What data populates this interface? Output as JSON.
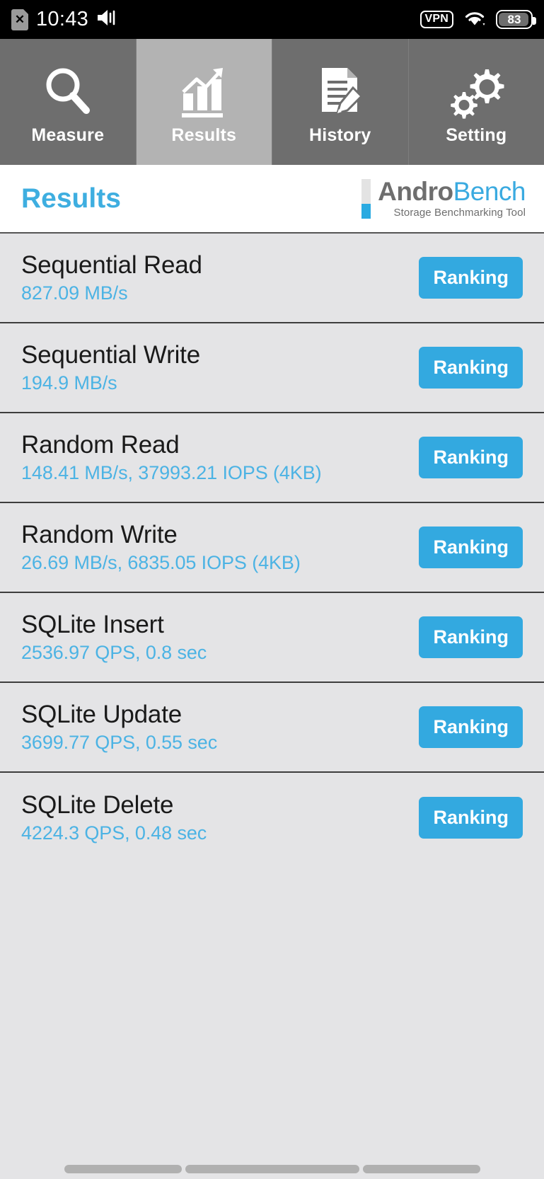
{
  "status_bar": {
    "sim_icon": "sim-card-disabled-icon",
    "sim_glyph": "✕",
    "time": "10:43",
    "volume_icon": "volume-on-icon",
    "vpn_label": "VPN",
    "wifi_icon": "wifi-icon",
    "battery_level": "83"
  },
  "tabs": [
    {
      "label": "Measure",
      "icon": "magnifier-icon",
      "active": false
    },
    {
      "label": "Results",
      "icon": "bar-chart-arrow-icon",
      "active": true
    },
    {
      "label": "History",
      "icon": "document-pen-icon",
      "active": false
    },
    {
      "label": "Setting",
      "icon": "gears-icon",
      "active": false
    }
  ],
  "header": {
    "title": "Results",
    "logo_andro": "Andro",
    "logo_bench": "Bench",
    "logo_tagline": "Storage Benchmarking Tool"
  },
  "colors": {
    "accent_blue": "#33a9e0",
    "value_blue": "#4cb3e4",
    "title_blue": "#3eaee0",
    "logo_gray": "#6e6e6e",
    "tab_bg": "#6e6e6e",
    "tab_active_bg": "#b3b3b3",
    "list_bg": "#e4e4e6",
    "row_divider": "#3d3d3d"
  },
  "results": [
    {
      "name": "Sequential Read",
      "value": "827.09 MB/s",
      "action": "Ranking"
    },
    {
      "name": "Sequential Write",
      "value": "194.9 MB/s",
      "action": "Ranking"
    },
    {
      "name": "Random Read",
      "value": "148.41 MB/s, 37993.21 IOPS (4KB)",
      "action": "Ranking"
    },
    {
      "name": "Random Write",
      "value": "26.69 MB/s, 6835.05 IOPS (4KB)",
      "action": "Ranking"
    },
    {
      "name": "SQLite Insert",
      "value": "2536.97 QPS, 0.8 sec",
      "action": "Ranking"
    },
    {
      "name": "SQLite Update",
      "value": "3699.77 QPS, 0.55 sec",
      "action": "Ranking"
    },
    {
      "name": "SQLite Delete",
      "value": "4224.3 QPS, 0.48 sec",
      "action": "Ranking"
    }
  ],
  "navbar": {
    "pills": 3
  }
}
